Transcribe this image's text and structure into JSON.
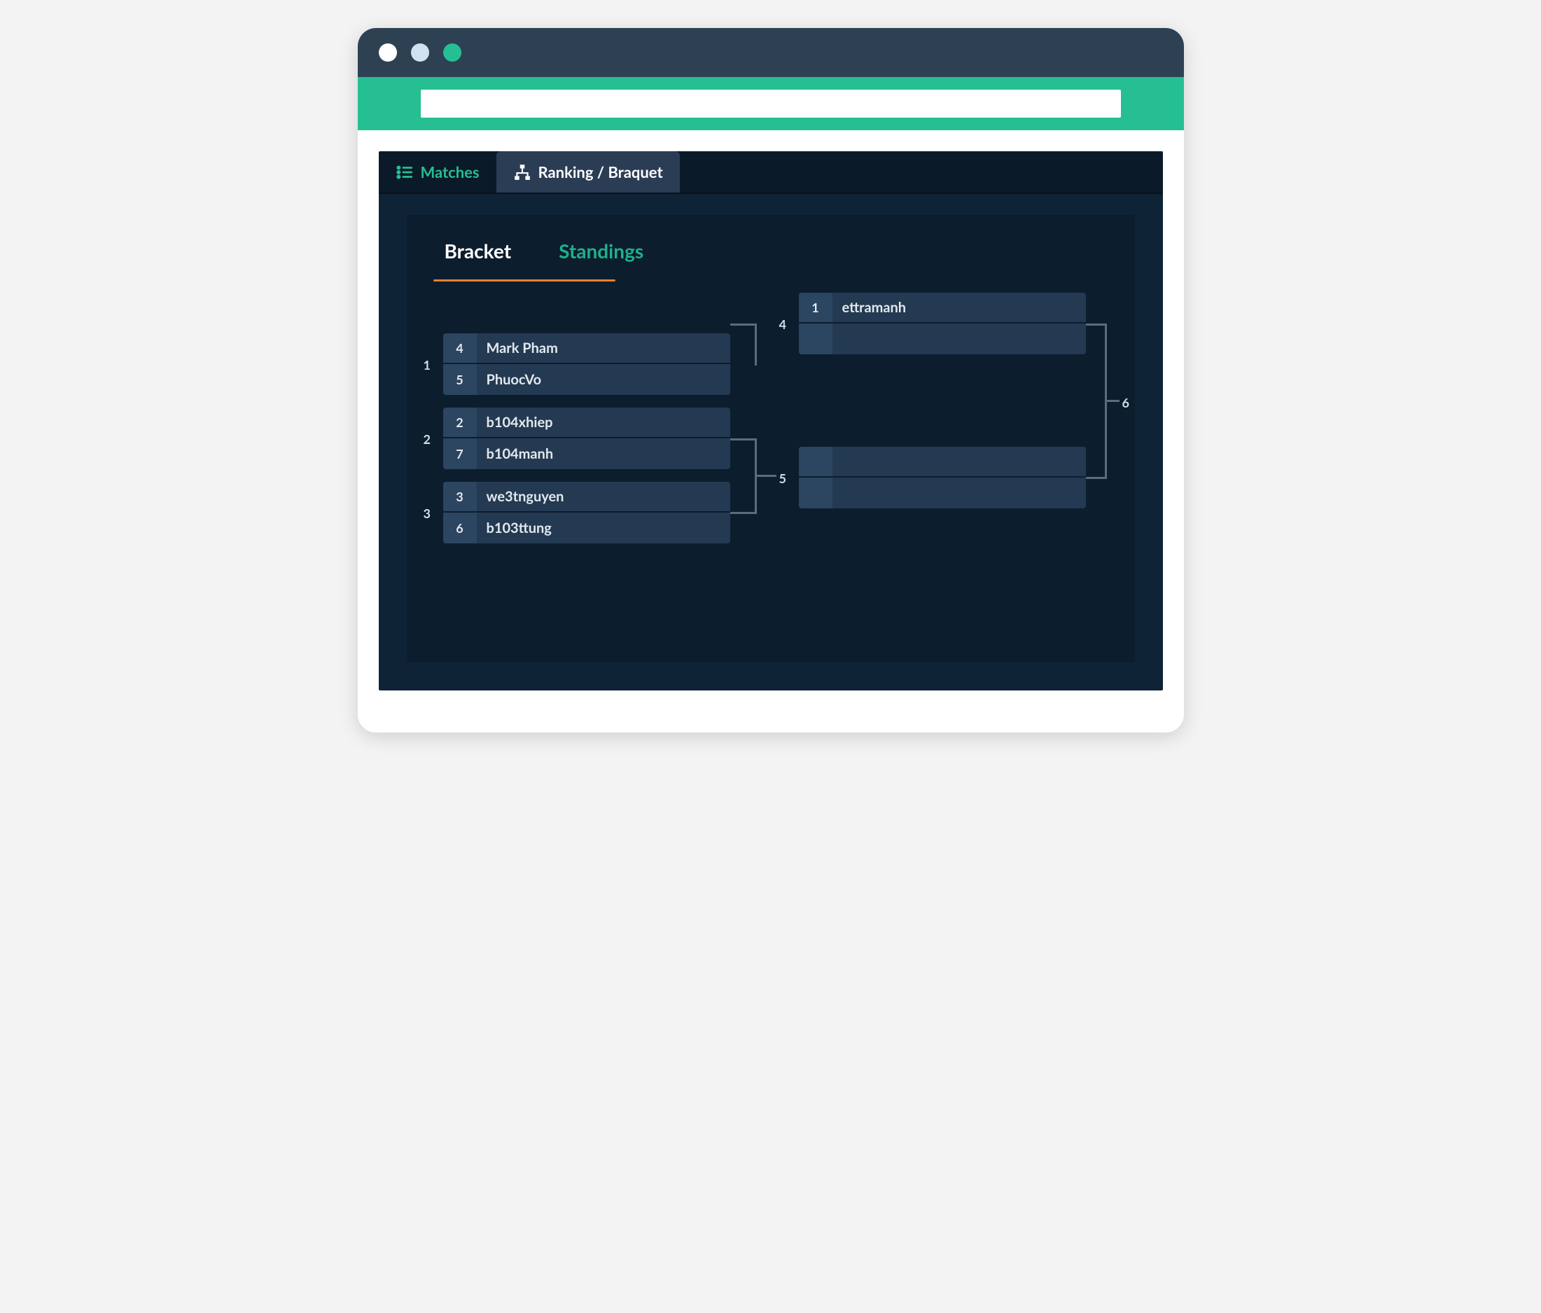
{
  "topTabs": {
    "matches": "Matches",
    "ranking": "Ranking / Braquet"
  },
  "subTabs": {
    "bracket": "Bracket",
    "standings": "Standings"
  },
  "matches": {
    "m1": {
      "label": "1",
      "p1": {
        "seed": "4",
        "name": "Mark Pham"
      },
      "p2": {
        "seed": "5",
        "name": "PhuocVo"
      }
    },
    "m2": {
      "label": "2",
      "p1": {
        "seed": "2",
        "name": "b104xhiep"
      },
      "p2": {
        "seed": "7",
        "name": "b104manh"
      }
    },
    "m3": {
      "label": "3",
      "p1": {
        "seed": "3",
        "name": "we3tnguyen"
      },
      "p2": {
        "seed": "6",
        "name": "b103ttung"
      }
    },
    "m4": {
      "label": "4",
      "p1": {
        "seed": "1",
        "name": "ettramanh"
      },
      "p2": {
        "seed": "",
        "name": ""
      }
    },
    "m5": {
      "label": "5",
      "p1": {
        "seed": "",
        "name": ""
      },
      "p2": {
        "seed": "",
        "name": ""
      }
    },
    "m6": {
      "label": "6"
    }
  }
}
